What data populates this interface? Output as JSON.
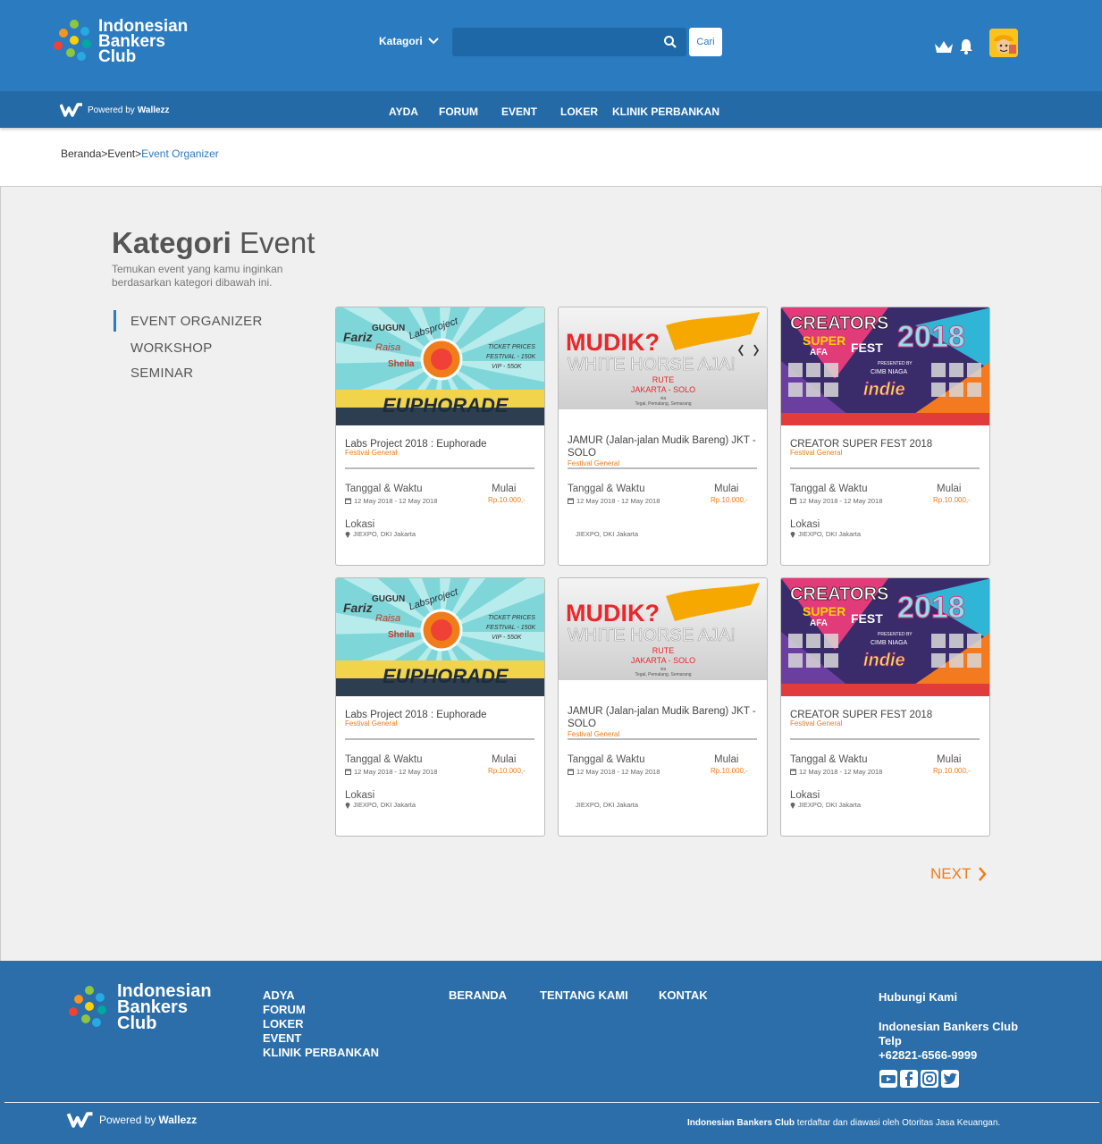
{
  "header": {
    "logo_lines": [
      "Indonesian",
      "Bankers",
      "Club"
    ],
    "kategori_label": "Katagori",
    "search_placeholder": "",
    "cari_label": "Cari"
  },
  "nav": {
    "powered_prefix": "Powered by",
    "powered_brand": "Wallezz",
    "links": [
      "AYDA",
      "FORUM",
      "EVENT",
      "LOKER",
      "KLINIK PERBANKAN"
    ]
  },
  "breadcrumb": {
    "items": [
      "Beranda",
      "Event",
      "Event Organizer"
    ],
    "separator": ">"
  },
  "page": {
    "title_bold": "Kategori",
    "title_rest": "Event",
    "subtitle": "Temukan event yang kamu inginkan berdasarkan kategori dibawah ini."
  },
  "sidebar": {
    "items": [
      "EVENT ORGANIZER",
      "WORKSHOP",
      "SEMINAR"
    ],
    "active": 0
  },
  "labels": {
    "tanggal": "Tanggal & Waktu",
    "mulai": "Mulai",
    "lokasi": "Lokasi"
  },
  "cards": [
    {
      "title": "Labs Project 2018 : Euphorade",
      "category": "Festival General",
      "date": "12 May 2018 - 12 May 2018",
      "price": "Rp.10.000,-",
      "location": "JIEXPO, DKI Jakarta",
      "banner": "euphorade",
      "show_lokasi": true
    },
    {
      "title": "JAMUR (Jalan-jalan Mudik Bareng) JKT - SOLO",
      "category": "Festival General",
      "date": "12 May 2018 - 12 May 2018",
      "price": "Rp.10.000,-",
      "location": "JIEXPO, DKI Jakarta",
      "banner": "mudik",
      "show_lokasi": false
    },
    {
      "title": "CREATOR SUPER FEST 2018",
      "category": "Festival General",
      "date": "12 May 2018 - 12 May 2018",
      "price": "Rp.10.000,-",
      "location": "JIEXPO, DKI Jakarta",
      "banner": "creators",
      "show_lokasi": true
    },
    {
      "title": "Labs Project 2018 : Euphorade",
      "category": "Festival General",
      "date": "12 May 2018 - 12 May 2018",
      "price": "Rp.10.000,-",
      "location": "JIEXPO, DKI Jakarta",
      "banner": "euphorade",
      "show_lokasi": true
    },
    {
      "title": "JAMUR (Jalan-jalan Mudik Bareng) JKT - SOLO",
      "category": "Festival General",
      "date": "12 May 2018 - 12 May 2018",
      "price": "Rp.10.000,-",
      "location": "JIEXPO, DKI Jakarta",
      "banner": "mudik",
      "show_lokasi": false
    },
    {
      "title": "CREATOR SUPER FEST 2018",
      "category": "Festival General",
      "date": "12 May 2018 - 12 May 2018",
      "price": "Rp.10.000,-",
      "location": "JIEXPO, DKI Jakarta",
      "banner": "creators",
      "show_lokasi": true
    }
  ],
  "banners": {
    "euphorade": {
      "headline": "EUPHORADE",
      "side_text": [
        "TICKET PRICES",
        "FESTIVAL - 150K",
        "VIP - 550K"
      ],
      "names": [
        "Fariz",
        "GUGUN",
        "Raisa",
        "Sheila",
        "Labsproject"
      ]
    },
    "mudik": {
      "headline": "MUDIK?",
      "subline": "WHITE HORSE AJA!",
      "rute": "RUTE",
      "route": "JAKARTA - SOLO",
      "via": "via",
      "via_cities": "Tegal, Pemalang, Semarang"
    },
    "creators": {
      "headline": "CREATORS",
      "super": "SUPER",
      "fest": "FEST",
      "afa": "AFA",
      "year": "2018",
      "presented": "PRESENTED BY",
      "sponsor": "CIMB NIAGA",
      "indie": "indie"
    }
  },
  "next_label": "NEXT",
  "footer": {
    "logo_lines": [
      "Indonesian",
      "Bankers",
      "Club"
    ],
    "col1": [
      "ADYA",
      "FORUM",
      "LOKER",
      "EVENT",
      "KLINIK PERBANKAN"
    ],
    "col2": [
      "BERANDA",
      "TENTANG KAMI",
      "KONTAK"
    ],
    "contact_heading": "Hubungi Kami",
    "contact_name": "Indonesian Bankers Club",
    "contact_telp_label": "Telp",
    "contact_phone": "+62821-6566-9999",
    "powered_prefix": "Powered by",
    "powered_brand": "Wallezz",
    "legal_bold": "Indonesian Bankers Club",
    "legal_rest": " terdaftar dan diawasi oleh Otoritas Jasa Keuangan."
  },
  "colors": {
    "primary": "#2b7bc1",
    "nav": "#246aa7",
    "footer": "#2b6ea9",
    "accent": "#f07d1a"
  }
}
